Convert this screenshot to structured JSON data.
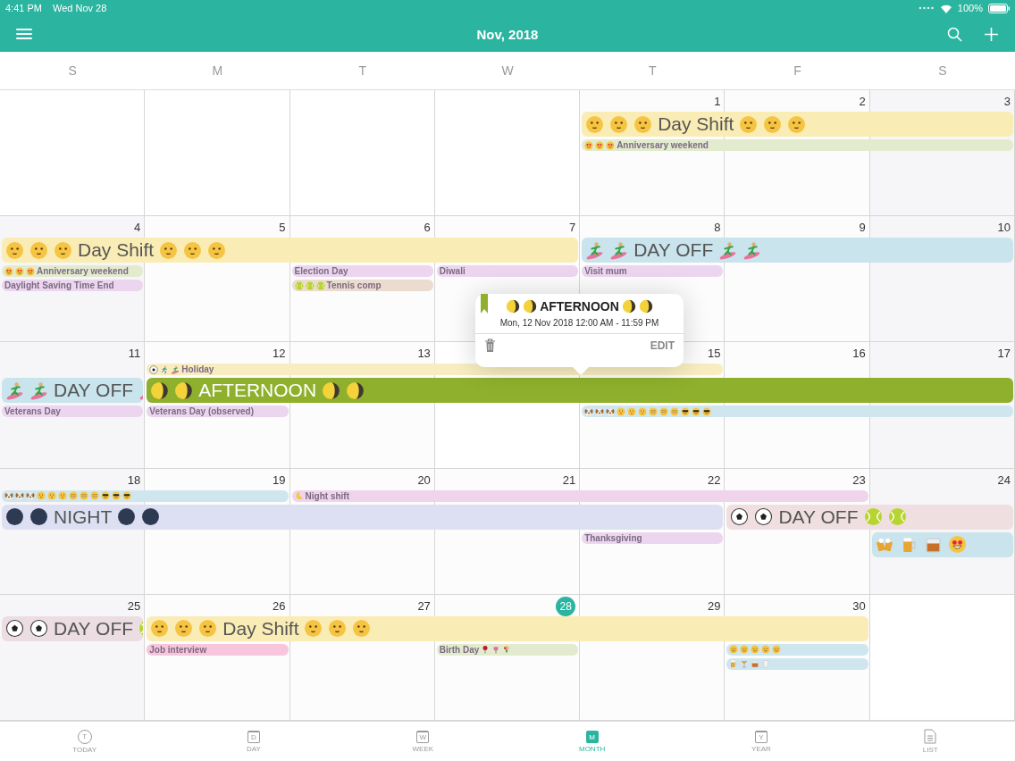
{
  "status_bar": {
    "time": "4:41 PM",
    "date": "Wed Nov 28",
    "battery": "100%"
  },
  "header": {
    "title": "Nov, 2018"
  },
  "weekdays": [
    "S",
    "M",
    "T",
    "W",
    "T",
    "F",
    "S"
  ],
  "weeks": [
    {
      "days": [
        {
          "kind": "blank"
        },
        {
          "kind": "blank"
        },
        {
          "kind": "blank"
        },
        {
          "kind": "blank"
        },
        {
          "label": "1",
          "today": false
        },
        {
          "label": "2",
          "today": false
        },
        {
          "label": "3",
          "today": false
        }
      ],
      "lanes": [
        [
          {
            "kind": "free"
          },
          {
            "kind": "free"
          },
          {
            "kind": "free"
          },
          {
            "kind": "free"
          },
          {
            "kind": "large",
            "color": "#faecb5",
            "title": "Day  Shift",
            "before": [
              {
                "kind": "smile"
              },
              {
                "kind": "smile"
              },
              {
                "kind": "smile"
              }
            ],
            "after": [
              {
                "kind": "smile"
              },
              {
                "kind": "smile"
              },
              {
                "kind": "smile"
              }
            ]
          },
          {
            "kind": "span"
          },
          {
            "kind": "span"
          }
        ],
        [
          {
            "kind": "free"
          },
          {
            "kind": "free"
          },
          {
            "kind": "free"
          },
          {
            "kind": "free"
          },
          {
            "kind": "small",
            "color": "#e3ebcf",
            "title": "Anniversary weekend",
            "before": [
              {
                "kind": "heart-eyes"
              },
              {
                "kind": "heart-eyes"
              },
              {
                "kind": "heart-eyes"
              }
            ]
          },
          {
            "kind": "span"
          },
          {
            "kind": "span"
          }
        ]
      ]
    },
    {
      "days": [
        {
          "label": "4",
          "today": false
        },
        {
          "label": "5",
          "today": false
        },
        {
          "label": "6",
          "today": false
        },
        {
          "label": "7",
          "today": false
        },
        {
          "label": "8",
          "today": false
        },
        {
          "label": "9",
          "today": false
        },
        {
          "label": "10",
          "today": false
        }
      ],
      "lanes": [
        [
          {
            "kind": "large",
            "color": "#faecb5",
            "title": "Day  Shift",
            "before": [
              {
                "kind": "smile"
              },
              {
                "kind": "smile"
              },
              {
                "kind": "smile"
              }
            ],
            "after": [
              {
                "kind": "smile"
              },
              {
                "kind": "smile"
              },
              {
                "kind": "smile"
              }
            ]
          },
          {
            "kind": "span"
          },
          {
            "kind": "span"
          },
          {
            "kind": "span"
          },
          {
            "kind": "large",
            "color": "#c9e4ec",
            "title": "DAY OFF",
            "before": [
              {
                "kind": "surfer"
              },
              {
                "kind": "surfer"
              }
            ],
            "after": [
              {
                "kind": "surfer"
              },
              {
                "kind": "surfer"
              }
            ]
          },
          {
            "kind": "span"
          },
          {
            "kind": "span"
          }
        ],
        [
          {
            "kind": "small",
            "color": "#e3ebcf",
            "title": "Anniversary weekend",
            "before": [
              {
                "kind": "heart-eyes"
              },
              {
                "kind": "heart-eyes"
              },
              {
                "kind": "heart-eyes"
              }
            ]
          },
          {
            "kind": "free"
          },
          {
            "kind": "small",
            "color": "#ecd6ef",
            "title": "Election Day"
          },
          {
            "kind": "small",
            "color": "#ecd6ef",
            "title": "Diwali"
          },
          {
            "kind": "small",
            "color": "#ecd6ef",
            "title": "Visit mum"
          },
          {
            "kind": "free"
          },
          {
            "kind": "free"
          }
        ],
        [
          {
            "kind": "small",
            "color": "#ecd6ef",
            "title": "Daylight Saving Time End"
          },
          {
            "kind": "free"
          },
          {
            "kind": "small",
            "color": "#ecdcd0",
            "title": "Tennis comp",
            "before": [
              {
                "kind": "tennis"
              },
              {
                "kind": "tennis"
              },
              {
                "kind": "tennis"
              }
            ]
          },
          {
            "kind": "free"
          },
          {
            "kind": "free"
          },
          {
            "kind": "free"
          },
          {
            "kind": "free"
          }
        ]
      ]
    },
    {
      "days": [
        {
          "label": "11",
          "today": false
        },
        {
          "label": "12",
          "today": false
        },
        {
          "label": "13",
          "today": false
        },
        {
          "kind": "blank"
        },
        {
          "label": "15",
          "today": false
        },
        {
          "label": "16",
          "today": false
        },
        {
          "label": "17",
          "today": false
        }
      ],
      "lanes": [
        [
          {
            "kind": "free"
          },
          {
            "kind": "small",
            "color": "#f8edc0",
            "title": "Holiday",
            "before": [
              {
                "kind": "soccer"
              },
              {
                "kind": "runner"
              },
              {
                "kind": "surfer"
              }
            ]
          },
          {
            "kind": "span"
          },
          {
            "kind": "span"
          },
          {
            "kind": "span"
          },
          {
            "kind": "free"
          },
          {
            "kind": "free"
          }
        ],
        [
          {
            "kind": "large",
            "color": "#c9e4ec",
            "title": "DAY OFF",
            "before": [
              {
                "kind": "surfer"
              },
              {
                "kind": "surfer"
              }
            ],
            "after": [
              {
                "kind": "surfer"
              }
            ]
          },
          {
            "kind": "large",
            "color": "#8fb02c",
            "title": "AFTERNOON",
            "before": [
              {
                "kind": "half-moon"
              },
              {
                "kind": "half-moon"
              }
            ],
            "after": [
              {
                "kind": "half-moon"
              },
              {
                "kind": "half-moon"
              }
            ]
          },
          {
            "kind": "span"
          },
          {
            "kind": "span"
          },
          {
            "kind": "span"
          },
          {
            "kind": "span"
          },
          {
            "kind": "span"
          }
        ],
        [
          {
            "kind": "small",
            "color": "#ecd6ef",
            "title": "Veterans Day"
          },
          {
            "kind": "small",
            "color": "#ecd6ef",
            "title": "Veterans Day (observed)"
          },
          {
            "kind": "free"
          },
          {
            "kind": "free"
          },
          {
            "kind": "small",
            "color": "#cfe6ee",
            "before": [
              {
                "kind": "dog"
              },
              {
                "kind": "dog"
              },
              {
                "kind": "dog"
              },
              {
                "kind": "smile"
              },
              {
                "kind": "smile"
              },
              {
                "kind": "smile"
              },
              {
                "kind": "grin"
              },
              {
                "kind": "grin"
              },
              {
                "kind": "grin"
              },
              {
                "kind": "sunglasses"
              },
              {
                "kind": "sunglasses"
              },
              {
                "kind": "sunglasses"
              }
            ]
          },
          {
            "kind": "span"
          },
          {
            "kind": "span"
          }
        ]
      ]
    },
    {
      "days": [
        {
          "label": "18",
          "today": false
        },
        {
          "label": "19",
          "today": false
        },
        {
          "label": "20",
          "today": false
        },
        {
          "label": "21",
          "today": false
        },
        {
          "label": "22",
          "today": false
        },
        {
          "label": "23",
          "today": false
        },
        {
          "label": "24",
          "today": false
        }
      ],
      "lanes": [
        [
          {
            "kind": "small",
            "color": "#cfe6ee",
            "before": [
              {
                "kind": "dog"
              },
              {
                "kind": "dog"
              },
              {
                "kind": "dog"
              },
              {
                "kind": "smile"
              },
              {
                "kind": "smile"
              },
              {
                "kind": "smile"
              },
              {
                "kind": "grin"
              },
              {
                "kind": "grin"
              },
              {
                "kind": "grin"
              },
              {
                "kind": "sunglasses"
              },
              {
                "kind": "sunglasses"
              },
              {
                "kind": "sunglasses"
              }
            ]
          },
          {
            "kind": "span"
          },
          {
            "kind": "small",
            "color": "#f0d4ec",
            "title": "Night shift",
            "before": [
              {
                "kind": "crescent"
              }
            ]
          },
          {
            "kind": "span"
          },
          {
            "kind": "span"
          },
          {
            "kind": "span"
          },
          {
            "kind": "free"
          }
        ],
        [
          {
            "kind": "large",
            "color": "#dde0f2",
            "title": "NIGHT",
            "before": [
              {
                "kind": "new-moon"
              },
              {
                "kind": "new-moon"
              }
            ],
            "after": [
              {
                "kind": "new-moon"
              },
              {
                "kind": "new-moon"
              }
            ]
          },
          {
            "kind": "span"
          },
          {
            "kind": "span"
          },
          {
            "kind": "span"
          },
          {
            "kind": "span"
          },
          {
            "kind": "large",
            "color": "#f0dfe0",
            "title": "DAY OFF",
            "before": [
              {
                "kind": "soccer"
              },
              {
                "kind": "soccer"
              }
            ],
            "after": [
              {
                "kind": "tennis"
              },
              {
                "kind": "tennis"
              }
            ]
          },
          {
            "kind": "span"
          }
        ],
        [
          {
            "kind": "free"
          },
          {
            "kind": "free"
          },
          {
            "kind": "free"
          },
          {
            "kind": "free"
          },
          {
            "kind": "small",
            "color": "#ecd6ef",
            "title": "Thanksgiving"
          },
          {
            "kind": "free"
          },
          {
            "kind": "large",
            "color": "#c9e4ec",
            "before": [
              {
                "kind": "beers"
              },
              {
                "kind": "beer"
              },
              {
                "kind": "whisky"
              },
              {
                "kind": "star-eyes"
              }
            ]
          }
        ]
      ]
    },
    {
      "days": [
        {
          "label": "25",
          "today": false
        },
        {
          "label": "26",
          "today": false
        },
        {
          "label": "27",
          "today": false
        },
        {
          "label": "28",
          "today": true
        },
        {
          "label": "29",
          "today": false
        },
        {
          "label": "30",
          "today": false
        },
        {
          "kind": "blank"
        }
      ],
      "lanes": [
        [
          {
            "kind": "large",
            "color": "#ecdde2",
            "title": "DAY OFF",
            "before": [
              {
                "kind": "soccer"
              },
              {
                "kind": "soccer"
              }
            ],
            "after": [
              {
                "kind": "tennis"
              }
            ]
          },
          {
            "kind": "large",
            "color": "#faecb5",
            "title": "Day  Shift",
            "before": [
              {
                "kind": "smile"
              },
              {
                "kind": "smile"
              },
              {
                "kind": "smile"
              }
            ],
            "after": [
              {
                "kind": "smile"
              },
              {
                "kind": "smile"
              },
              {
                "kind": "smile"
              }
            ]
          },
          {
            "kind": "span"
          },
          {
            "kind": "span"
          },
          {
            "kind": "span"
          },
          {
            "kind": "span"
          },
          {
            "kind": "free"
          }
        ],
        [
          {
            "kind": "free"
          },
          {
            "kind": "small",
            "color": "#f7c6dc",
            "title": "Job interview"
          },
          {
            "kind": "free"
          },
          {
            "kind": "small",
            "color": "#e3ebcf",
            "title": "Birth Day",
            "after": [
              {
                "kind": "rose"
              },
              {
                "kind": "tulip"
              },
              {
                "kind": "bouquet"
              }
            ]
          },
          {
            "kind": "free"
          },
          {
            "kind": "small",
            "color": "#cfe6ee",
            "before": [
              {
                "kind": "relieved"
              },
              {
                "kind": "relieved"
              },
              {
                "kind": "relieved"
              },
              {
                "kind": "relieved"
              },
              {
                "kind": "relieved"
              }
            ]
          },
          {
            "kind": "free"
          }
        ],
        [
          {
            "kind": "free"
          },
          {
            "kind": "free"
          },
          {
            "kind": "free"
          },
          {
            "kind": "free"
          },
          {
            "kind": "free"
          },
          {
            "kind": "small",
            "color": "#cfe6ee",
            "before": [
              {
                "kind": "beer"
              },
              {
                "kind": "cocktail"
              },
              {
                "kind": "whisky"
              },
              {
                "kind": "milk"
              }
            ]
          },
          {
            "kind": "free"
          }
        ]
      ]
    }
  ],
  "popover": {
    "title": "AFTERNOON",
    "before": [
      {
        "kind": "half-moon"
      },
      {
        "kind": "half-moon"
      }
    ],
    "after": [
      {
        "kind": "half-moon"
      },
      {
        "kind": "half-moon"
      }
    ],
    "time": "Mon, 12 Nov 2018 12:00 AM - 11:59 PM",
    "action": "EDIT"
  },
  "tabs": [
    {
      "label": "TODAY",
      "glyph": "T",
      "kind": "circle",
      "selected": false
    },
    {
      "label": "DAY",
      "glyph": "D",
      "kind": "calendar",
      "selected": false
    },
    {
      "label": "WEEK",
      "glyph": "W",
      "kind": "calendar",
      "selected": false
    },
    {
      "label": "MONTH",
      "glyph": "M",
      "kind": "calendar",
      "selected": true
    },
    {
      "label": "YEAR",
      "glyph": "Y",
      "kind": "calendar",
      "selected": false
    },
    {
      "label": "LIST",
      "kind": "document",
      "selected": false
    }
  ]
}
